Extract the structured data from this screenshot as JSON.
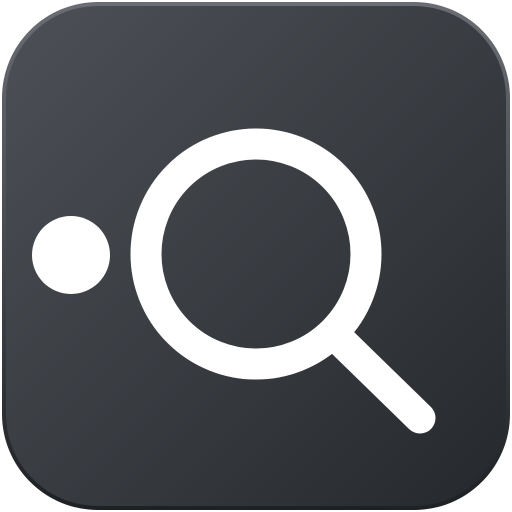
{
  "icon": {
    "name": "search-app-icon",
    "glyph": "magnifying-glass-icon",
    "indicator": "dot-icon"
  },
  "colors": {
    "tile_top": "#4d5157",
    "tile_bottom": "#25282c",
    "tile_edge": "#5c6066",
    "glyph": "#ffffff"
  }
}
